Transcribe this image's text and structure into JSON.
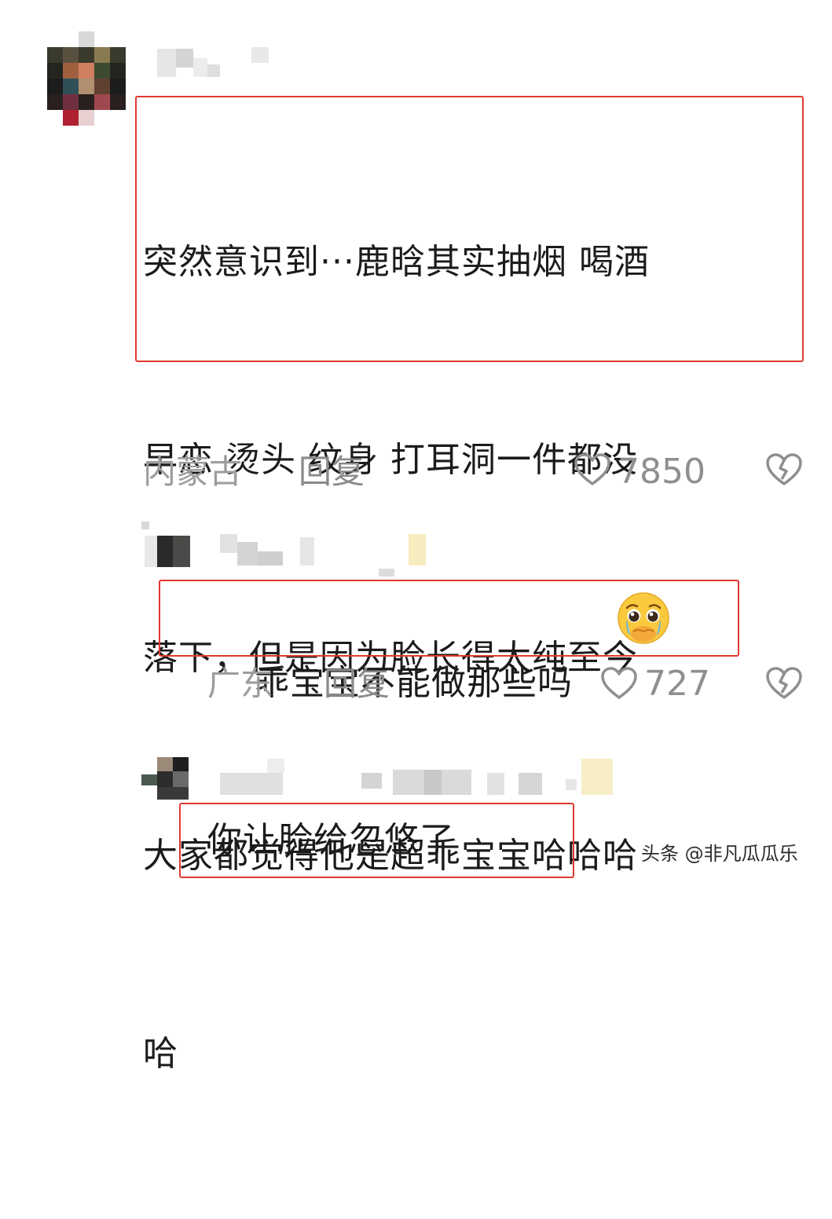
{
  "comments": [
    {
      "text_lines": [
        "突然意识到···鹿晗其实抽烟 喝酒",
        "早恋 烫头 纹身 打耳洞一件都没",
        "落下，但是因为脸长得太纯至今",
        "大家都觉得他是超乖宝宝哈哈哈",
        "哈"
      ],
      "location": "内蒙古",
      "reply_label": "回复",
      "likes": "7850"
    },
    {
      "text": "乖宝宝不能做那些吗",
      "emoji": "🥹",
      "location": "广东",
      "reply_label": "回复",
      "likes": "727"
    },
    {
      "text": "你让脸给忽悠了"
    }
  ],
  "icons": {
    "like": "heart-outline-icon",
    "dislike": "broken-heart-icon"
  },
  "colors": {
    "highlight_box": "#e0392f",
    "meta_text": "#9d9d9d"
  },
  "watermark": "头条 @非凡瓜瓜乐"
}
